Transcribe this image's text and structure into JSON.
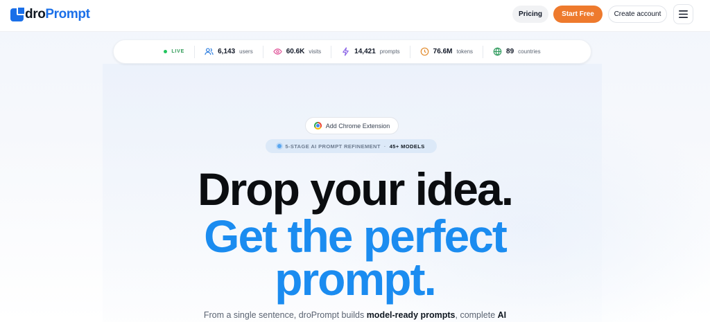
{
  "brand": {
    "logo_prefix": "dro",
    "logo_suffix": "Prompt"
  },
  "header": {
    "pricing_label": "Pricing",
    "start_label": "Start Free",
    "create_label": "Create account",
    "menu_icon": "hamburger-icon"
  },
  "stats": {
    "live": "LIVE",
    "items": [
      {
        "icon": "users-icon",
        "value": "6,143",
        "label": "users",
        "color": "#2f7fe0"
      },
      {
        "icon": "eye-icon",
        "value": "60.6K",
        "label": "visits",
        "color": "#e0559a"
      },
      {
        "icon": "bolt-icon",
        "value": "14,421",
        "label": "prompts",
        "color": "#8a63e6"
      },
      {
        "icon": "clock-icon",
        "value": "76.6M",
        "label": "tokens",
        "color": "#e28a2b"
      },
      {
        "icon": "globe-icon",
        "value": "89",
        "label": "countries",
        "color": "#2e9a5c"
      }
    ]
  },
  "extension": {
    "label": "Add Chrome Extension"
  },
  "badge": {
    "stages": "5-STAGE AI PROMPT REFINEMENT",
    "separator": "·",
    "models": "45+ MODELS"
  },
  "hero": {
    "line1": "Drop your idea.",
    "line2": "Get the perfect",
    "line3": "prompt.",
    "sub_before": "From a single sentence, droPrompt builds ",
    "sub_bold1": "model-ready prompts",
    "sub_middle": ", complete ",
    "sub_bold2": "AI"
  },
  "colors": {
    "accent": "#1b8cf0",
    "cta": "#ee7a2d",
    "live": "#22c55e"
  }
}
